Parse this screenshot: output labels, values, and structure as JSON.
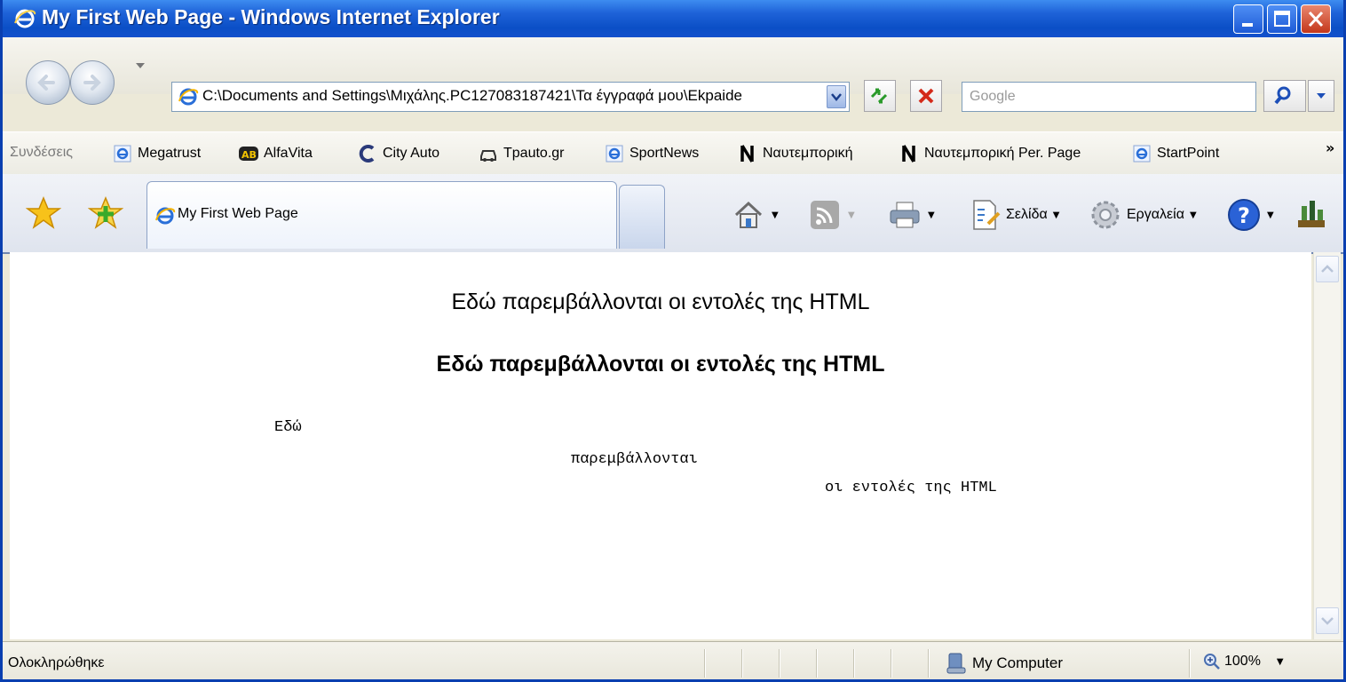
{
  "window": {
    "title": "My First Web Page - Windows Internet Explorer"
  },
  "address_bar": {
    "url": "C:\\Documents and Settings\\Μιχάλης.PC127083187421\\Τα έγγραφά μου\\Ekpaide"
  },
  "search": {
    "placeholder": "Google"
  },
  "links_bar": {
    "label": "Συνδέσεις",
    "items": [
      {
        "label": "Megatrust",
        "icon": "ie-page-icon"
      },
      {
        "label": "AlfaVita",
        "icon": "ab-logo-icon"
      },
      {
        "label": "City Auto",
        "icon": "c-logo-icon"
      },
      {
        "label": "Tpauto.gr",
        "icon": "car-icon"
      },
      {
        "label": "SportNews",
        "icon": "ie-page-icon"
      },
      {
        "label": "Ναυτεμπορική",
        "icon": "n-logo-icon"
      },
      {
        "label": "Ναυτεμπορική Per. Page",
        "icon": "n-logo-icon"
      },
      {
        "label": "StartPoint",
        "icon": "ie-page-icon"
      }
    ],
    "overflow": "»"
  },
  "tab": {
    "title": "My First Web Page"
  },
  "command_bar": {
    "page_label": "Σελίδα",
    "tools_label": "Εργαλεία"
  },
  "content": {
    "line_plain": "Εδώ παρεμβάλλονται οι εντολές της HTML",
    "line_bold": "Εδώ παρεμβάλλονται οι εντολές της HTML",
    "pre_1": "Εδώ",
    "pre_2": "παρεμβάλλονται",
    "pre_3": "οι εντολές της HTML"
  },
  "status_bar": {
    "status": "Ολοκληρώθηκε",
    "zone": "My Computer",
    "zoom": "100%"
  },
  "colors": {
    "titlebar": "#0b4fc6",
    "close_button": "#c4371a",
    "content_bg": "#ffffff"
  }
}
